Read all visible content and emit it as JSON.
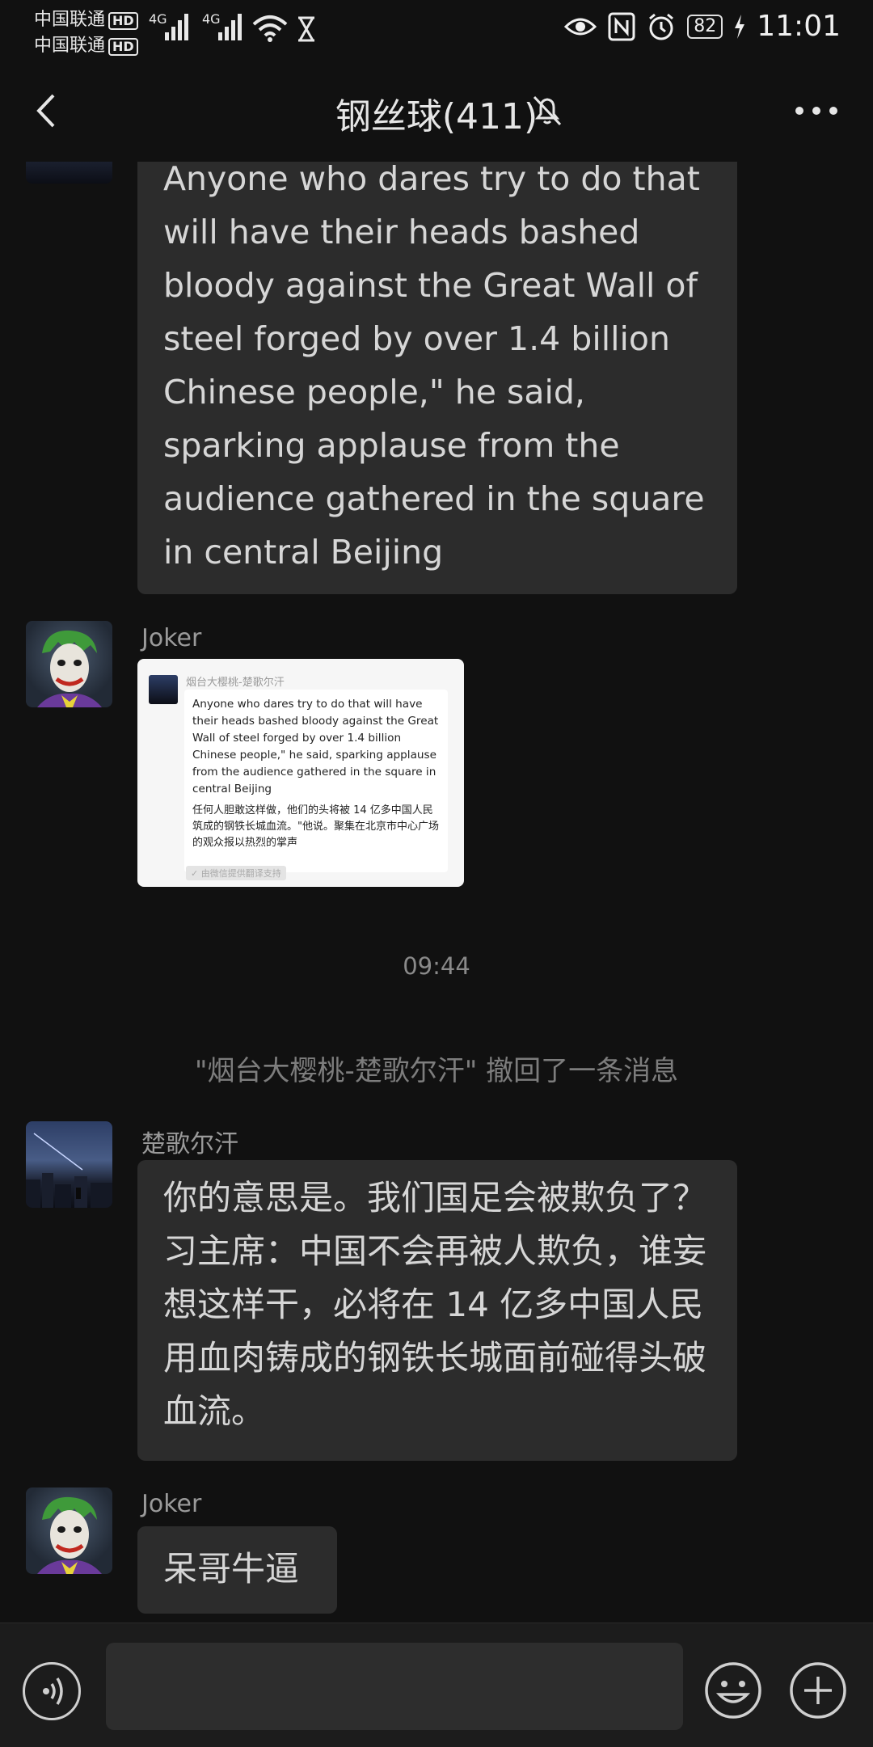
{
  "status_bar": {
    "carrier_1": "中国联通",
    "carrier_2": "中国联通",
    "hd_label": "HD",
    "network_1": "4G",
    "network_2": "4G",
    "battery": "82",
    "time": "11:01"
  },
  "header": {
    "title": "钢丝球(411)"
  },
  "messages": {
    "m1_text": "Anyone who dares try to do that will have their heads bashed bloody against the Great Wall of steel forged by over 1.4 billion Chinese people,\" he said, sparking applause from the audience gathered in the square in central Beijing",
    "m2_sender": "Joker",
    "m2_image": {
      "sender": "烟台大樱桃-楚歌尔汗",
      "en_text": "Anyone who dares try to do that will have their heads bashed bloody against the Great Wall of steel forged by over 1.4 billion Chinese people,\" he said, sparking applause from the audience gathered in the square in central Beijing",
      "cn_text": "任何人胆敢这样做，他们的头将被 14 亿多中国人民筑成的钢铁长城血流。\"他说。聚集在北京市中心广场的观众报以热烈的掌声",
      "tag": "✓ 由微信提供翻译支持"
    },
    "timestamp": "09:44",
    "system_notice": "\"烟台大樱桃-楚歌尔汗\" 撤回了一条消息",
    "m3_sender": "楚歌尔汗",
    "m3_text": "你的意思是。我们国足会被欺负了？ 习主席：中国不会再被人欺负，谁妄想这样干，必将在 14 亿多中国人民用血肉铸成的钢铁长城面前碰得头破血流。",
    "m4_sender": "Joker",
    "m4_text": "呆哥牛逼"
  },
  "input": {
    "value": "",
    "placeholder": ""
  },
  "icons": [
    "back-icon",
    "mute-bell-icon",
    "more-icon",
    "voice-icon",
    "emoji-icon",
    "plus-icon",
    "eye-icon",
    "nfc-icon",
    "alarm-icon",
    "wifi-icon",
    "hourglass-icon",
    "charging-icon"
  ]
}
